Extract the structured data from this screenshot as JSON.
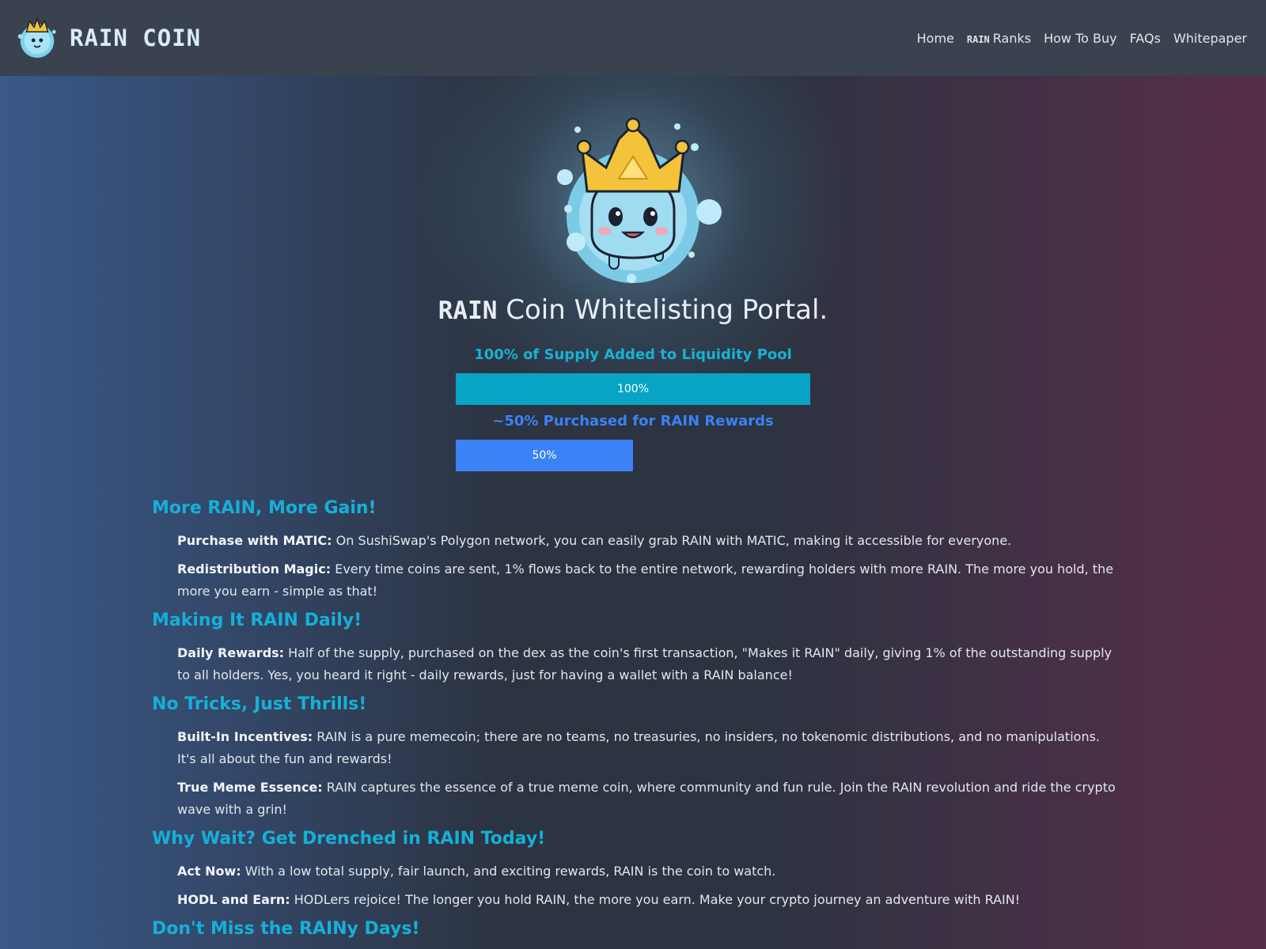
{
  "nav": {
    "brand": "RAIN COIN",
    "links": [
      {
        "prefix": "",
        "label": "Home"
      },
      {
        "prefix": "RAIN",
        "label": "Ranks"
      },
      {
        "prefix": "",
        "label": "How To Buy"
      },
      {
        "prefix": "",
        "label": "FAQs"
      },
      {
        "prefix": "",
        "label": "Whitepaper"
      }
    ]
  },
  "hero": {
    "title_prefix": "RAIN",
    "title": "Coin Whitelisting Portal.",
    "progress": [
      {
        "label": "100% of Supply Added to Liquidity Pool",
        "value_text": "100%",
        "fraction": 1.0,
        "color": "#07a4c5"
      },
      {
        "label": "~50% Purchased for RAIN Rewards",
        "value_text": "50%",
        "fraction": 0.5,
        "color": "#3b82f6"
      }
    ]
  },
  "sections": [
    {
      "title": "More RAIN, More Gain!",
      "items": [
        {
          "lead": "Purchase with MATIC:",
          "text": " On SushiSwap's Polygon network, you can easily grab RAIN with MATIC, making it accessible for everyone."
        },
        {
          "lead": "Redistribution Magic:",
          "text": " Every time coins are sent, 1% flows back to the entire network, rewarding holders with more RAIN. The more you hold, the more you earn - simple as that!"
        }
      ]
    },
    {
      "title": "Making It RAIN Daily!",
      "items": [
        {
          "lead": "Daily Rewards:",
          "text": " Half of the supply, purchased on the dex as the coin's first transaction, \"Makes it RAIN\" daily, giving 1% of the outstanding supply to all holders. Yes, you heard it right - daily rewards, just for having a wallet with a RAIN balance!"
        }
      ]
    },
    {
      "title": "No Tricks, Just Thrills!",
      "items": [
        {
          "lead": "Built-In Incentives:",
          "text": " RAIN is a pure memecoin; there are no teams, no treasuries, no insiders, no tokenomic distributions, and no manipulations. It's all about the fun and rewards!"
        },
        {
          "lead": "True Meme Essence:",
          "text": " RAIN captures the essence of a true meme coin, where community and fun rule. Join the RAIN revolution and ride the crypto wave with a grin!"
        }
      ]
    },
    {
      "title": "Why Wait? Get Drenched in RAIN Today!",
      "items": [
        {
          "lead": "Act Now:",
          "text": " With a low total supply, fair launch, and exciting rewards, RAIN is the coin to watch."
        },
        {
          "lead": "HODL and Earn:",
          "text": " HODLers rejoice! The longer you hold RAIN, the more you earn. Make your crypto journey an adventure with RAIN!"
        }
      ]
    },
    {
      "title": "Don't Miss the RAINy Days!",
      "items": []
    }
  ]
}
